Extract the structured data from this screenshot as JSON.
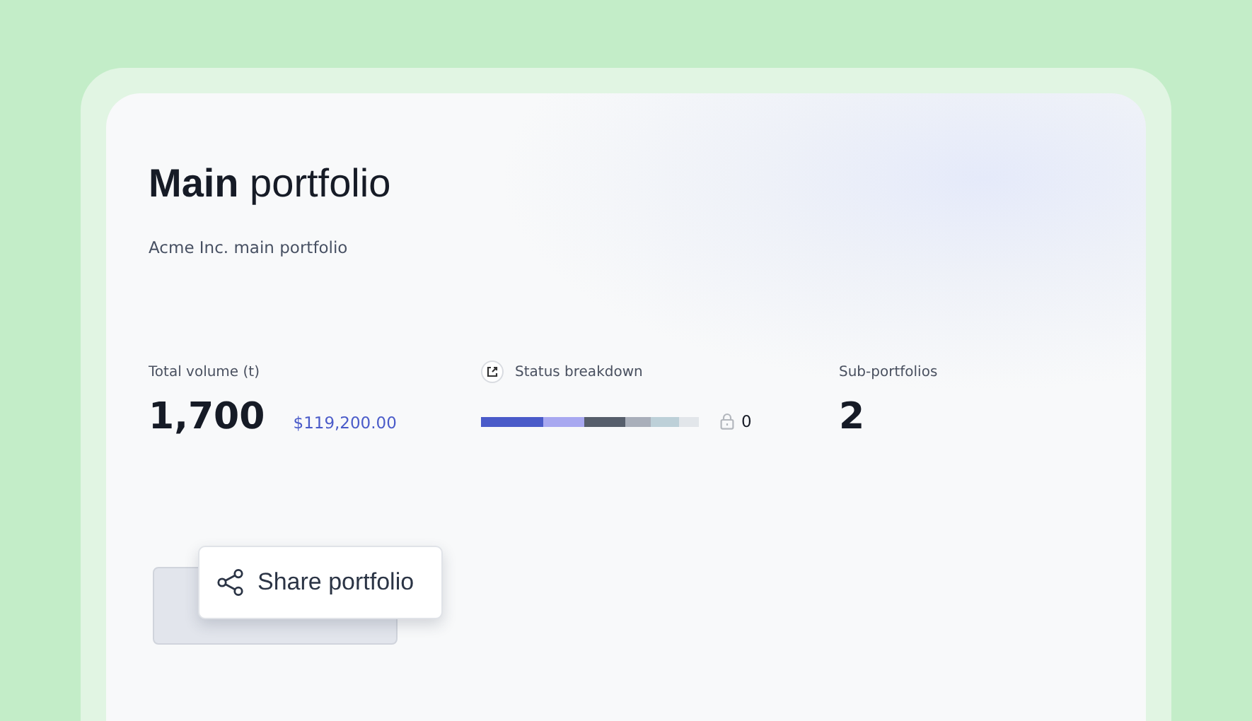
{
  "title": "**Main** portfolio",
  "subtitle": "Acme Inc. main portfolio",
  "stats": [
    {
      "kind": "volume",
      "label": "Total volume (t)",
      "value": "1,700",
      "secondary": "$119,200.00"
    },
    {
      "kind": "breakdown",
      "label": "Status breakdown",
      "segments": [
        {
          "color": "#4a5bc9"
        },
        {
          "color": "#a8a8f0"
        },
        {
          "color": "#565e6b"
        },
        {
          "color": "#a9afba"
        },
        {
          "color": "#bdd0d8"
        },
        {
          "color": "#e2e6ea"
        }
      ],
      "locked": "0"
    },
    {
      "kind": "count",
      "label": "Sub-portfolios",
      "value": "2"
    }
  ],
  "share_button": {
    "label": "Share portfolio"
  }
}
